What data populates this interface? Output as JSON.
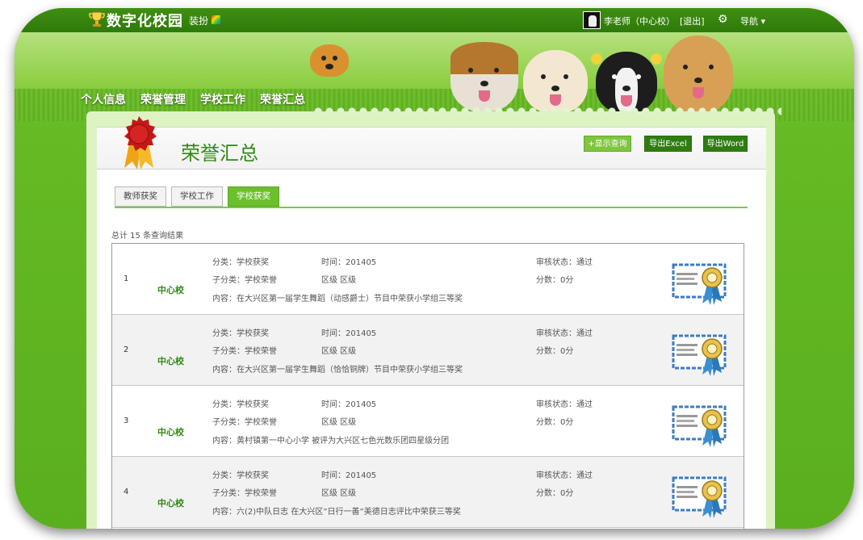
{
  "app": {
    "logo_text": "数字化校园",
    "skin_label": "装扮",
    "user_label": "李老师（中心校）",
    "logout_label": "[退出]",
    "nav_menu_label": "导航 ▾"
  },
  "main_nav": [
    "个人信息",
    "荣誉管理",
    "学校工作",
    "荣誉汇总"
  ],
  "page": {
    "title": "荣誉汇总",
    "buttons": {
      "query": "+显示查询",
      "excel": "导出Excel",
      "word": "导出Word"
    },
    "tabs": [
      {
        "label": "教师获奖",
        "active": false
      },
      {
        "label": "学校工作",
        "active": false
      },
      {
        "label": "学校获奖",
        "active": true
      }
    ],
    "result_count": "总计 15 条查询结果"
  },
  "records": [
    {
      "num": "1",
      "school": "中心校",
      "category": "分类：学校获奖",
      "time": "时间：201405",
      "status": "审核状态：通过",
      "subcategory": "子分类：学校荣誉",
      "level": "区级 区级",
      "score": "分数：0分",
      "content": "内容：在大兴区第一届学生舞蹈（动感爵士）节目中荣获小学组三等奖"
    },
    {
      "num": "2",
      "school": "中心校",
      "category": "分类：学校获奖",
      "time": "时间：201405",
      "status": "审核状态：通过",
      "subcategory": "子分类：学校荣誉",
      "level": "区级 区级",
      "score": "分数：0分",
      "content": "内容：在大兴区第一届学生舞蹈（恰恰铜牌）节目中荣获小学组三等奖"
    },
    {
      "num": "3",
      "school": "中心校",
      "category": "分类：学校获奖",
      "time": "时间：201405",
      "status": "审核状态：通过",
      "subcategory": "子分类：学校荣誉",
      "level": "区级 区级",
      "score": "分数：0分",
      "content": "内容：黄村镇第一中心小学 被评为大兴区七色光数乐团四星级分团"
    },
    {
      "num": "4",
      "school": "中心校",
      "category": "分类：学校获奖",
      "time": "时间：201405",
      "status": "审核状态：通过",
      "subcategory": "子分类：学校荣誉",
      "level": "区级 区级",
      "score": "分数：0分",
      "content": "内容：六(2)中队日志 在大兴区”日行一善”美德日志评比中荣获三等奖"
    }
  ]
}
